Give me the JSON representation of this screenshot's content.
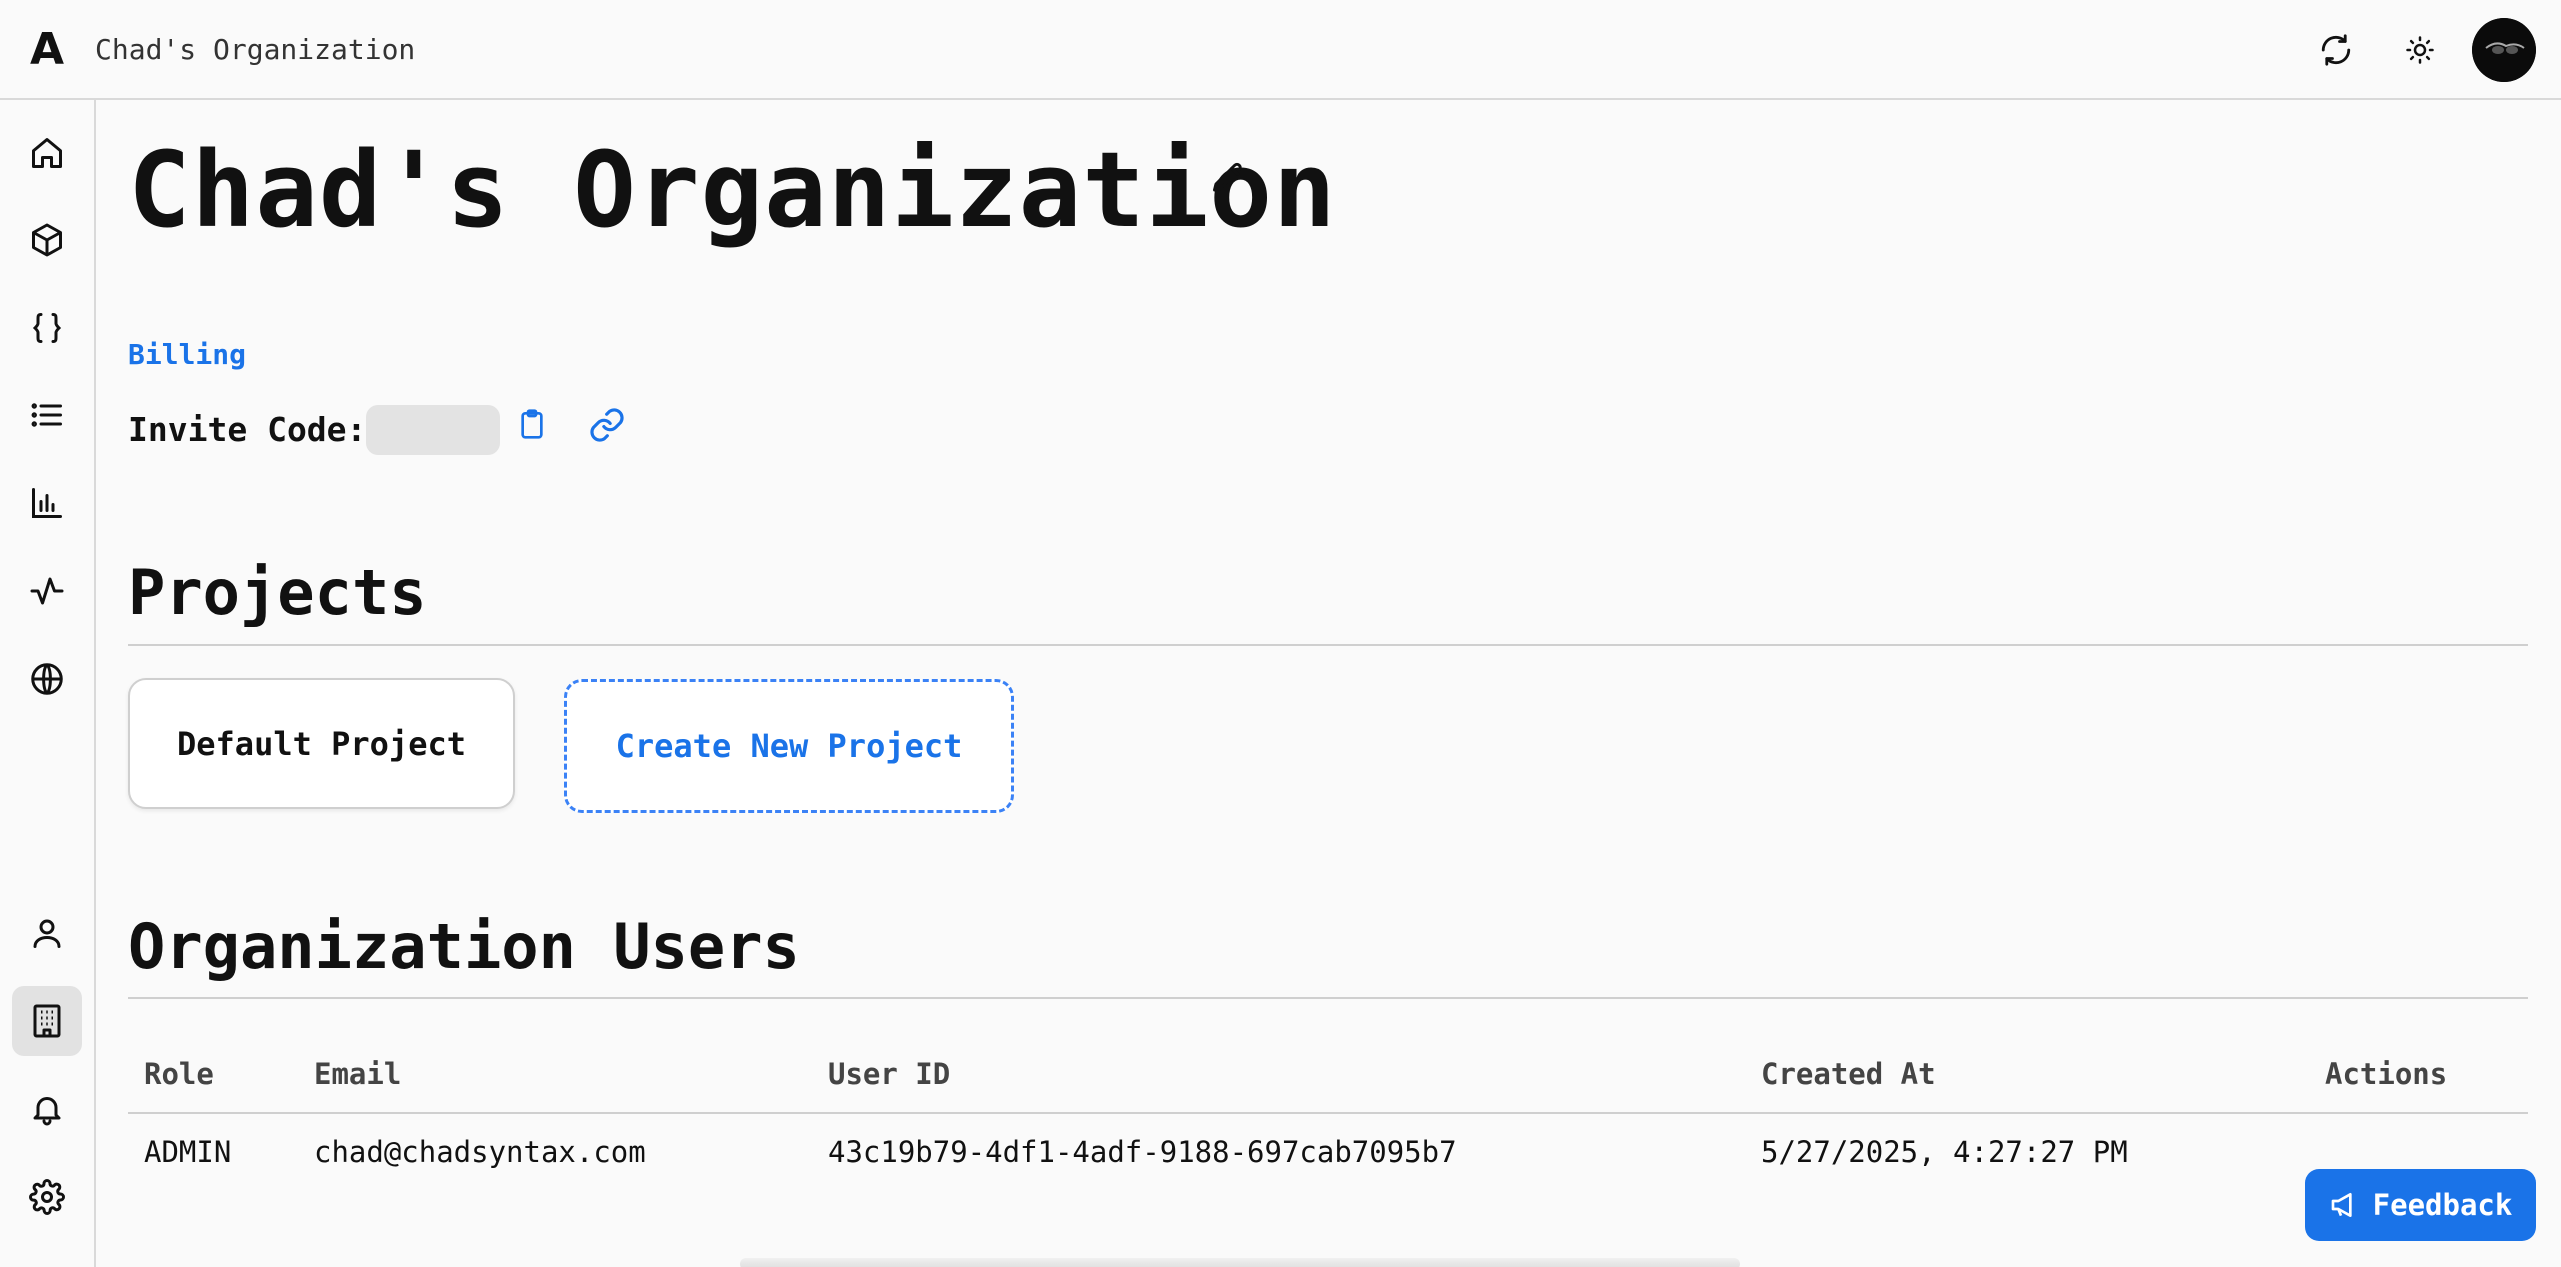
{
  "header": {
    "logo_text": "A",
    "org_name": "Chad's Organization",
    "refresh_icon": "refresh-icon",
    "theme_icon": "sun-icon",
    "avatar_icon": "avatar"
  },
  "sidebar": {
    "items": [
      {
        "name": "home",
        "icon": "home-icon"
      },
      {
        "name": "models",
        "icon": "cube-icon"
      },
      {
        "name": "code",
        "icon": "braces-icon"
      },
      {
        "name": "list",
        "icon": "list-icon"
      },
      {
        "name": "analytics",
        "icon": "bar-chart-icon"
      },
      {
        "name": "activity",
        "icon": "activity-icon"
      },
      {
        "name": "web",
        "icon": "globe-icon"
      },
      {
        "name": "profile",
        "icon": "user-icon"
      },
      {
        "name": "organization",
        "icon": "building-icon",
        "active": true
      },
      {
        "name": "notifications",
        "icon": "bell-icon"
      },
      {
        "name": "settings",
        "icon": "gear-icon"
      }
    ]
  },
  "page": {
    "title": "Chad's Organization",
    "billing_link": "Billing",
    "invite_label": "Invite Code:"
  },
  "projects": {
    "heading": "Projects",
    "items": [
      "Default Project"
    ],
    "create_label": "Create New Project"
  },
  "users": {
    "heading": "Organization Users",
    "columns": [
      "Role",
      "Email",
      "User ID",
      "Created At",
      "Actions"
    ],
    "rows": [
      {
        "role": "ADMIN",
        "email": "chad@chadsyntax.com",
        "user_id": "43c19b79-4df1-4adf-9188-697cab7095b7",
        "created_at": "5/27/2025, 4:27:27 PM"
      }
    ]
  },
  "feedback": {
    "label": "Feedback"
  },
  "colors": {
    "accent": "#1a73e8",
    "dashed_border": "#3b82f6",
    "background": "#fafafa"
  }
}
